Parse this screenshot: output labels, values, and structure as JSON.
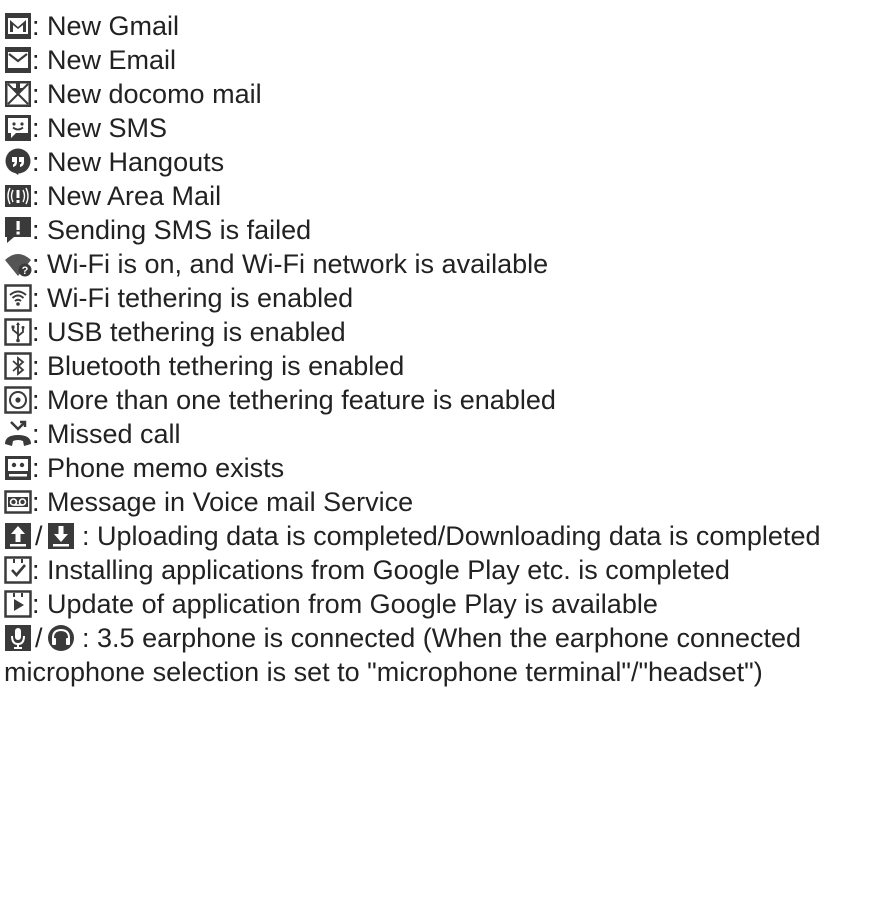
{
  "items": [
    {
      "icon": "gmail-icon",
      "text": ": New Gmail"
    },
    {
      "icon": "email-icon",
      "text": ": New Email"
    },
    {
      "icon": "docomo-mail-icon",
      "text": ": New docomo mail"
    },
    {
      "icon": "sms-icon",
      "text": ": New SMS"
    },
    {
      "icon": "hangouts-icon",
      "text": ": New Hangouts"
    },
    {
      "icon": "area-mail-icon",
      "text": ": New Area Mail"
    },
    {
      "icon": "sms-failed-icon",
      "text": ": Sending SMS is failed"
    },
    {
      "icon": "wifi-available-icon",
      "text": ": Wi-Fi is on, and Wi-Fi network is available"
    },
    {
      "icon": "wifi-tethering-icon",
      "text": ": Wi-Fi tethering is enabled"
    },
    {
      "icon": "usb-tethering-icon",
      "text": ": USB tethering is enabled"
    },
    {
      "icon": "bluetooth-tethering-icon",
      "text": ": Bluetooth tethering is enabled"
    },
    {
      "icon": "multi-tethering-icon",
      "text": ": More than one tethering feature is enabled"
    },
    {
      "icon": "missed-call-icon",
      "text": ": Missed call"
    },
    {
      "icon": "phone-memo-icon",
      "text": ": Phone memo exists"
    },
    {
      "icon": "voicemail-icon",
      "text": ": Message in Voice mail Service"
    }
  ],
  "upload_download": {
    "icons": [
      "upload-complete-icon",
      "download-complete-icon"
    ],
    "separator": "/",
    "text": ": Uploading data is completed/Downloading data is completed"
  },
  "install_complete": {
    "icon": "install-complete-icon",
    "text": ": Installing applications from Google Play etc. is completed"
  },
  "update_available": {
    "icon": "update-available-icon",
    "text": ": Update of application from Google Play is available"
  },
  "earphone": {
    "icons": [
      "microphone-icon",
      "headset-icon"
    ],
    "separator": "/",
    "text": ":    3.5 earphone is connected (When the earphone connected microphone selection is set to \"microphone terminal\"/\"headset\")"
  }
}
